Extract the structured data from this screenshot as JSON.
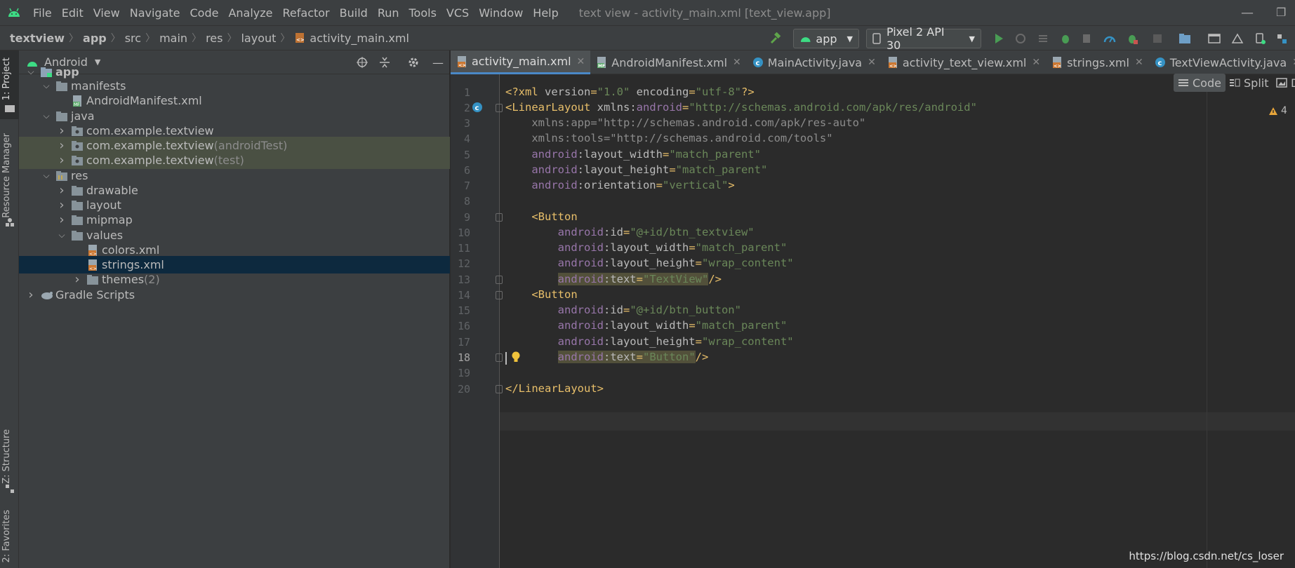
{
  "titlebar": {
    "menu": [
      "File",
      "Edit",
      "View",
      "Navigate",
      "Code",
      "Analyze",
      "Refactor",
      "Build",
      "Run",
      "Tools",
      "VCS",
      "Window",
      "Help"
    ],
    "window_title": "text view - activity_main.xml [text_view.app]"
  },
  "navbar": {
    "breadcrumb": [
      "textview",
      "app",
      "src",
      "main",
      "res",
      "layout",
      "activity_main.xml"
    ],
    "run_config": "app",
    "device": "Pixel 2 API 30"
  },
  "left_strip": {
    "project_tab": "1: Project",
    "resource_tab": "Resource Manager",
    "structure_tab": "Z: Structure",
    "favorites_tab": "2: Favorites"
  },
  "project_panel": {
    "view_mode": "Android",
    "tree": [
      {
        "label": "app",
        "suffix": "",
        "depth": 0,
        "arrow": "expanded",
        "icon": "module-folder-icon",
        "bold": true
      },
      {
        "label": "manifests",
        "suffix": "",
        "depth": 1,
        "arrow": "expanded",
        "icon": "folder-icon"
      },
      {
        "label": "AndroidManifest.xml",
        "suffix": "",
        "depth": 2,
        "arrow": "none",
        "icon": "manifest-file-icon"
      },
      {
        "label": "java",
        "suffix": "",
        "depth": 1,
        "arrow": "expanded",
        "icon": "folder-icon"
      },
      {
        "label": "com.example.textview",
        "suffix": "",
        "depth": 2,
        "arrow": "collapsed",
        "icon": "package-icon"
      },
      {
        "label": "com.example.textview",
        "suffix": " (androidTest)",
        "depth": 2,
        "arrow": "collapsed",
        "icon": "package-icon",
        "highlight": "green"
      },
      {
        "label": "com.example.textview",
        "suffix": " (test)",
        "depth": 2,
        "arrow": "collapsed",
        "icon": "package-icon",
        "highlight": "green"
      },
      {
        "label": "res",
        "suffix": "",
        "depth": 1,
        "arrow": "expanded",
        "icon": "res-folder-icon"
      },
      {
        "label": "drawable",
        "suffix": "",
        "depth": 2,
        "arrow": "collapsed",
        "icon": "folder-icon"
      },
      {
        "label": "layout",
        "suffix": "",
        "depth": 2,
        "arrow": "collapsed",
        "icon": "folder-icon"
      },
      {
        "label": "mipmap",
        "suffix": "",
        "depth": 2,
        "arrow": "collapsed",
        "icon": "folder-icon"
      },
      {
        "label": "values",
        "suffix": "",
        "depth": 2,
        "arrow": "expanded",
        "icon": "folder-icon"
      },
      {
        "label": "colors.xml",
        "suffix": "",
        "depth": 3,
        "arrow": "none",
        "icon": "xml-file-icon"
      },
      {
        "label": "strings.xml",
        "suffix": "",
        "depth": 3,
        "arrow": "none",
        "icon": "xml-file-icon",
        "highlight": "selected"
      },
      {
        "label": "themes",
        "suffix": " (2)",
        "depth": 3,
        "arrow": "collapsed",
        "icon": "folder-icon"
      },
      {
        "label": "Gradle Scripts",
        "suffix": "",
        "depth": 0,
        "arrow": "collapsed",
        "icon": "gradle-icon"
      }
    ]
  },
  "editor_tabs": [
    {
      "label": "activity_main.xml",
      "icon": "xml-file-icon",
      "active": true
    },
    {
      "label": "AndroidManifest.xml",
      "icon": "manifest-file-icon",
      "active": false
    },
    {
      "label": "MainActivity.java",
      "icon": "java-class-icon",
      "active": false
    },
    {
      "label": "activity_text_view.xml",
      "icon": "xml-file-icon",
      "active": false
    },
    {
      "label": "strings.xml",
      "icon": "xml-file-icon",
      "active": false
    },
    {
      "label": "TextViewActivity.java",
      "icon": "java-class-icon",
      "active": false
    }
  ],
  "view_modes": {
    "code": "Code",
    "split": "Split",
    "design": "D"
  },
  "warning_count": "4",
  "code_lines": [
    [
      [
        "p",
        "<?"
      ],
      [
        "t",
        "xml "
      ],
      [
        "a",
        "version"
      ],
      [
        "p",
        "="
      ],
      [
        "s",
        "\"1.0\""
      ],
      [
        "a",
        " encoding"
      ],
      [
        "p",
        "="
      ],
      [
        "s",
        "\"utf-8\""
      ],
      [
        "p",
        "?>"
      ]
    ],
    [
      [
        "t",
        "<LinearLayout "
      ],
      [
        "a",
        "xmlns:"
      ],
      [
        "n",
        "android"
      ],
      [
        "p",
        "="
      ],
      [
        "s",
        "\"http://schemas.android.com/apk/res/android\""
      ]
    ],
    [
      [
        "g",
        "    xmlns:app=\"http://schemas.android.com/apk/res-auto\""
      ]
    ],
    [
      [
        "g",
        "    xmlns:tools=\"http://schemas.android.com/tools\""
      ]
    ],
    [
      [
        "n",
        "    android"
      ],
      [
        "a",
        ":layout_width"
      ],
      [
        "p",
        "="
      ],
      [
        "s",
        "\"match_parent\""
      ]
    ],
    [
      [
        "n",
        "    android"
      ],
      [
        "a",
        ":layout_height"
      ],
      [
        "p",
        "="
      ],
      [
        "s",
        "\"match_parent\""
      ]
    ],
    [
      [
        "n",
        "    android"
      ],
      [
        "a",
        ":orientation"
      ],
      [
        "p",
        "="
      ],
      [
        "s",
        "\"vertical\""
      ],
      [
        "t",
        ">"
      ]
    ],
    [],
    [
      [
        "t",
        "    <Button"
      ]
    ],
    [
      [
        "n",
        "        android"
      ],
      [
        "a",
        ":id"
      ],
      [
        "p",
        "="
      ],
      [
        "s",
        "\"@+id/btn_textview\""
      ]
    ],
    [
      [
        "n",
        "        android"
      ],
      [
        "a",
        ":layout_width"
      ],
      [
        "p",
        "="
      ],
      [
        "s",
        "\"match_parent\""
      ]
    ],
    [
      [
        "n",
        "        android"
      ],
      [
        "a",
        ":layout_height"
      ],
      [
        "p",
        "="
      ],
      [
        "s",
        "\"wrap_content\""
      ]
    ],
    [
      [
        "n",
        "        "
      ],
      [
        "nh",
        "android"
      ],
      [
        "ah",
        ":text"
      ],
      [
        "ph",
        "="
      ],
      [
        "sh",
        "\"TextView\""
      ],
      [
        "t",
        "/>"
      ]
    ],
    [
      [
        "t",
        "    <Button"
      ]
    ],
    [
      [
        "n",
        "        android"
      ],
      [
        "a",
        ":id"
      ],
      [
        "p",
        "="
      ],
      [
        "s",
        "\"@+id/btn_button\""
      ]
    ],
    [
      [
        "n",
        "        android"
      ],
      [
        "a",
        ":layout_width"
      ],
      [
        "p",
        "="
      ],
      [
        "s",
        "\"match_parent\""
      ]
    ],
    [
      [
        "n",
        "        android"
      ],
      [
        "a",
        ":layout_height"
      ],
      [
        "p",
        "="
      ],
      [
        "s",
        "\"wrap_content\""
      ]
    ],
    [
      [
        "n",
        "        "
      ],
      [
        "nh",
        "android"
      ],
      [
        "ah",
        ":text"
      ],
      [
        "ph",
        "="
      ],
      [
        "sh",
        "\"Button\""
      ],
      [
        "t",
        "/>"
      ]
    ],
    [],
    [
      [
        "t",
        "</LinearLayout>"
      ]
    ]
  ],
  "watermark": "https://blog.csdn.net/cs_loser"
}
